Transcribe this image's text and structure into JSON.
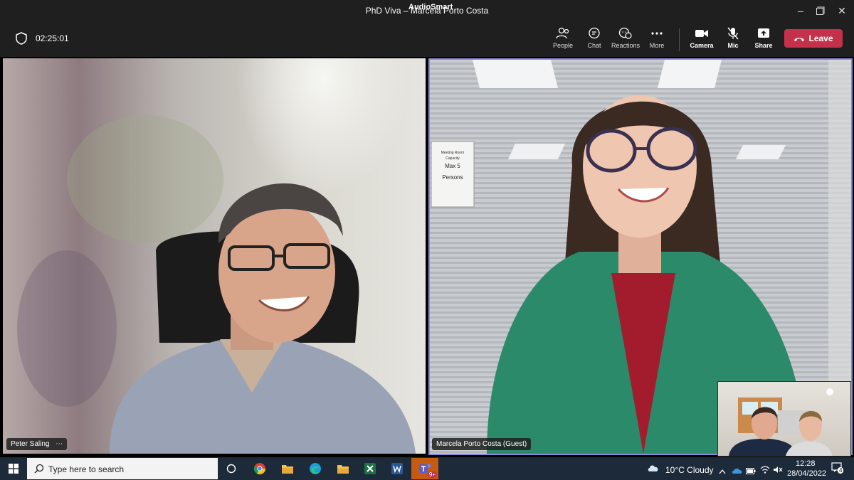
{
  "window": {
    "title": "PhD Viva – Marcela Porto Costa",
    "overlay_label": "AudioSmart"
  },
  "meeting": {
    "timer": "02:25:01",
    "toolbar": {
      "people": "People",
      "chat": "Chat",
      "reactions": "Reactions",
      "more": "More",
      "camera": "Camera",
      "mic": "Mic",
      "share": "Share",
      "leave": "Leave"
    },
    "participants": {
      "left_name": "Peter Saling",
      "right_name": "Marcela Porto Costa (Guest)"
    },
    "sign_text": {
      "line1": "Meeting Room",
      "line2": "Capacity",
      "line3": "Max 5",
      "line4": "Persons"
    }
  },
  "taskbar": {
    "search_placeholder": "Type here to search",
    "teams_badge": "9+",
    "weather": "10°C  Cloudy",
    "time": "12:28",
    "date": "28/04/2022",
    "notifications_count": "4"
  },
  "colors": {
    "leave": "#c4314b",
    "active_border": "#8b89d9",
    "taskbar": "#1c2a3a"
  }
}
